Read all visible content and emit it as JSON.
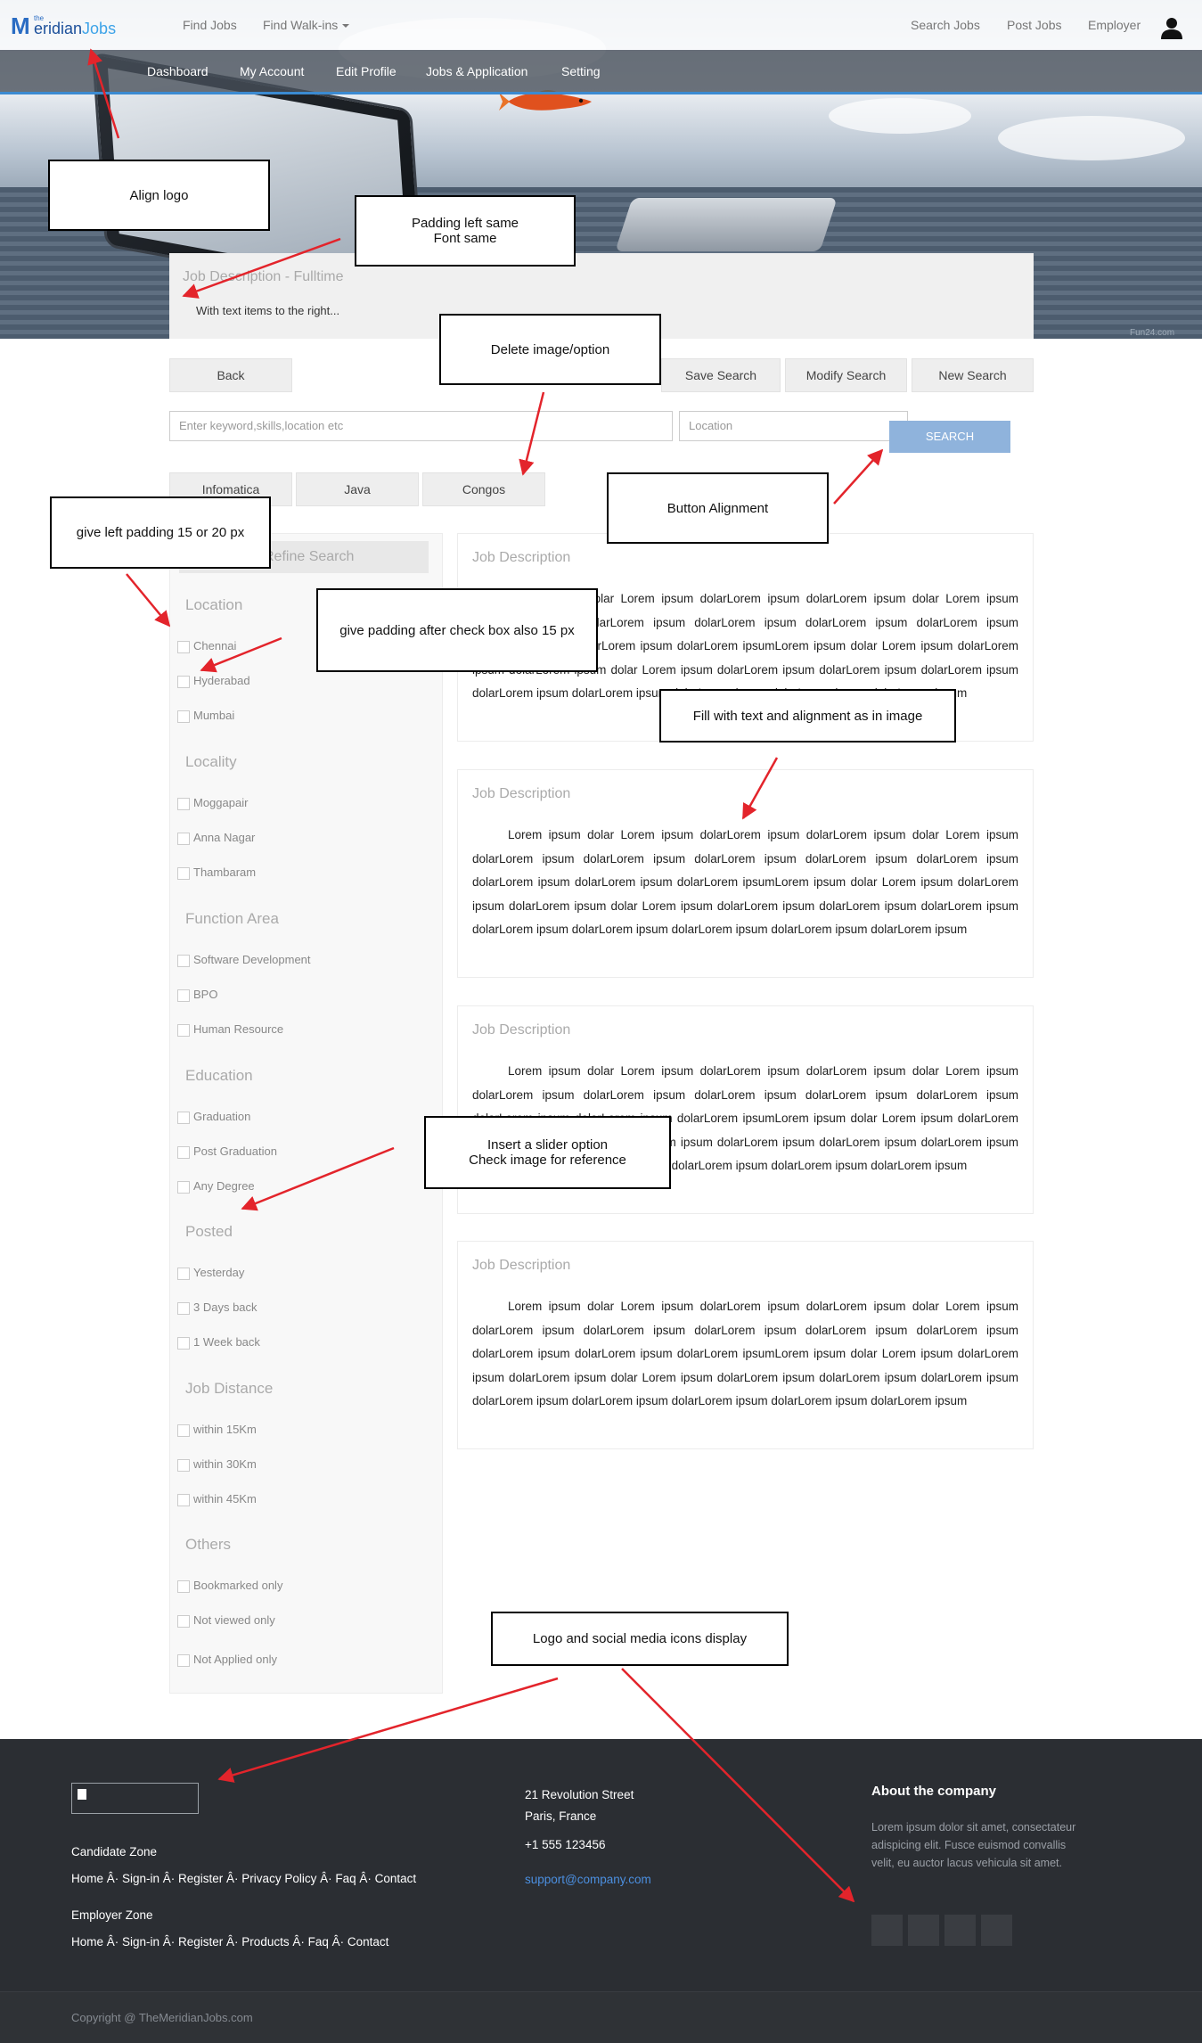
{
  "topbar": {
    "logo": {
      "m": "M",
      "the": "the",
      "eridian": "eridian",
      "jobs": "Jobs"
    },
    "left_items": [
      "Find Jobs",
      "Find Walk-ins"
    ],
    "right_items": [
      "Search Jobs",
      "Post Jobs",
      "Employer"
    ]
  },
  "subnav": {
    "items": [
      "Dashboard",
      "My Account",
      "Edit Profile",
      "Jobs & Application",
      "Setting"
    ]
  },
  "hero": {
    "watermark": "Fun24.com"
  },
  "job_header": {
    "title": "Job Description - Fulltime",
    "subtitle": "With text items to the right..."
  },
  "actions": {
    "back": "Back",
    "save_search": "Save Search",
    "modify_search": "Modify Search",
    "new_search": "New Search"
  },
  "search": {
    "keyword_placeholder": "Enter keyword,skills,location etc",
    "location_placeholder": "Location",
    "button": "SEARCH"
  },
  "tags": [
    "Infomatica",
    "Java",
    "Congos"
  ],
  "sidebar": {
    "refine_title": "Refine Search",
    "sections": [
      {
        "title": "Location",
        "options": [
          "Chennai",
          "Hyderabad",
          "Mumbai"
        ]
      },
      {
        "title": "Locality",
        "options": [
          "Moggapair",
          "Anna Nagar",
          "Thambaram"
        ]
      },
      {
        "title": "Function Area",
        "options": [
          "Software Development",
          "BPO",
          "Human Resource"
        ]
      },
      {
        "title": "Education",
        "options": [
          "Graduation",
          "Post Graduation",
          "Any Degree"
        ]
      },
      {
        "title": "Posted",
        "options": [
          "Yesterday",
          "3 Days back",
          "1 Week back"
        ]
      },
      {
        "title": "Job Distance",
        "options": [
          "within 15Km",
          "within 30Km",
          "within 45Km"
        ]
      },
      {
        "title": "Others",
        "options": [
          "Bookmarked only",
          "Not viewed only",
          "Not Applied only"
        ]
      }
    ]
  },
  "jobs": [
    {
      "title": "Job Description",
      "text": "Lorem ipsum dolar Lorem ipsum dolarLorem ipsum dolarLorem ipsum dolar Lorem ipsum dolarLorem ipsum dolarLorem ipsum dolarLorem ipsum dolarLorem ipsum dolarLorem ipsum dolarLorem ipsum dolarLorem ipsum dolarLorem ipsumLorem ipsum dolar Lorem ipsum dolarLorem ipsum dolarLorem ipsum dolar Lorem ipsum dolarLorem ipsum dolarLorem ipsum dolarLorem ipsum dolarLorem ipsum dolarLorem ipsum dolarLorem ipsum dolarLorem ipsum dolarLorem ipsum"
    },
    {
      "title": "Job Description",
      "text": "Lorem ipsum dolar Lorem ipsum dolarLorem ipsum dolarLorem ipsum dolar Lorem ipsum dolarLorem ipsum dolarLorem ipsum dolarLorem ipsum dolarLorem ipsum dolarLorem ipsum dolarLorem ipsum dolarLorem ipsum dolarLorem ipsumLorem ipsum dolar Lorem ipsum dolarLorem ipsum dolarLorem ipsum dolar Lorem ipsum dolarLorem ipsum dolarLorem ipsum dolarLorem ipsum dolarLorem ipsum dolarLorem ipsum dolarLorem ipsum dolarLorem ipsum dolarLorem ipsum"
    },
    {
      "title": "Job Description",
      "text": "Lorem ipsum dolar Lorem ipsum dolarLorem ipsum dolarLorem ipsum dolar Lorem ipsum dolarLorem ipsum dolarLorem ipsum dolarLorem ipsum dolarLorem ipsum dolarLorem ipsum dolarLorem ipsum dolarLorem ipsum dolarLorem ipsumLorem ipsum dolar Lorem ipsum dolarLorem ipsum dolarLorem ipsum dolar Lorem ipsum dolarLorem ipsum dolarLorem ipsum dolarLorem ipsum dolarLorem ipsum dolarLorem ipsum dolarLorem ipsum dolarLorem ipsum dolarLorem ipsum"
    },
    {
      "title": "Job Description",
      "text": "Lorem ipsum dolar Lorem ipsum dolarLorem ipsum dolarLorem ipsum dolar Lorem ipsum dolarLorem ipsum dolarLorem ipsum dolarLorem ipsum dolarLorem ipsum dolarLorem ipsum dolarLorem ipsum dolarLorem ipsum dolarLorem ipsumLorem ipsum dolar Lorem ipsum dolarLorem ipsum dolarLorem ipsum dolar Lorem ipsum dolarLorem ipsum dolarLorem ipsum dolarLorem ipsum dolarLorem ipsum dolarLorem ipsum dolarLorem ipsum dolarLorem ipsum dolarLorem ipsum"
    }
  ],
  "footer": {
    "candidate_zone": "Candidate Zone",
    "candidate_links": "Home Â· Sign-in Â· Register Â· Privacy Policy Â· Faq Â· Contact",
    "employer_zone": "Employer Zone",
    "employer_links": "Home Â· Sign-in Â· Register Â· Products Â· Faq Â· Contact",
    "address1": "21 Revolution Street",
    "address2": "Paris, France",
    "phone": "+1 555 123456",
    "email": "support@company.com",
    "about_title": "About the company",
    "about_text": "Lorem ipsum dolor sit amet, consectateur adispicing elit. Fusce euismod convallis velit, eu auctor lacus vehicula sit amet.",
    "copyright": "Copyright @ TheMeridianJobs.com"
  },
  "annotations": [
    "Align logo",
    "Padding left same",
    "Font same",
    "Delete image/option",
    "Button Alignment",
    "give left padding 15 or 20 px",
    "give padding after check box also 15 px",
    "Fill with text and alignment as in image",
    "Insert a slider option",
    "Check image for reference",
    "Logo and social media icons display"
  ],
  "colors": {
    "accent": "#3b8ad1",
    "search_button": "#8fb3dc",
    "footer_bg": "#2b2e33",
    "annotation_arrow": "#e3242b"
  }
}
